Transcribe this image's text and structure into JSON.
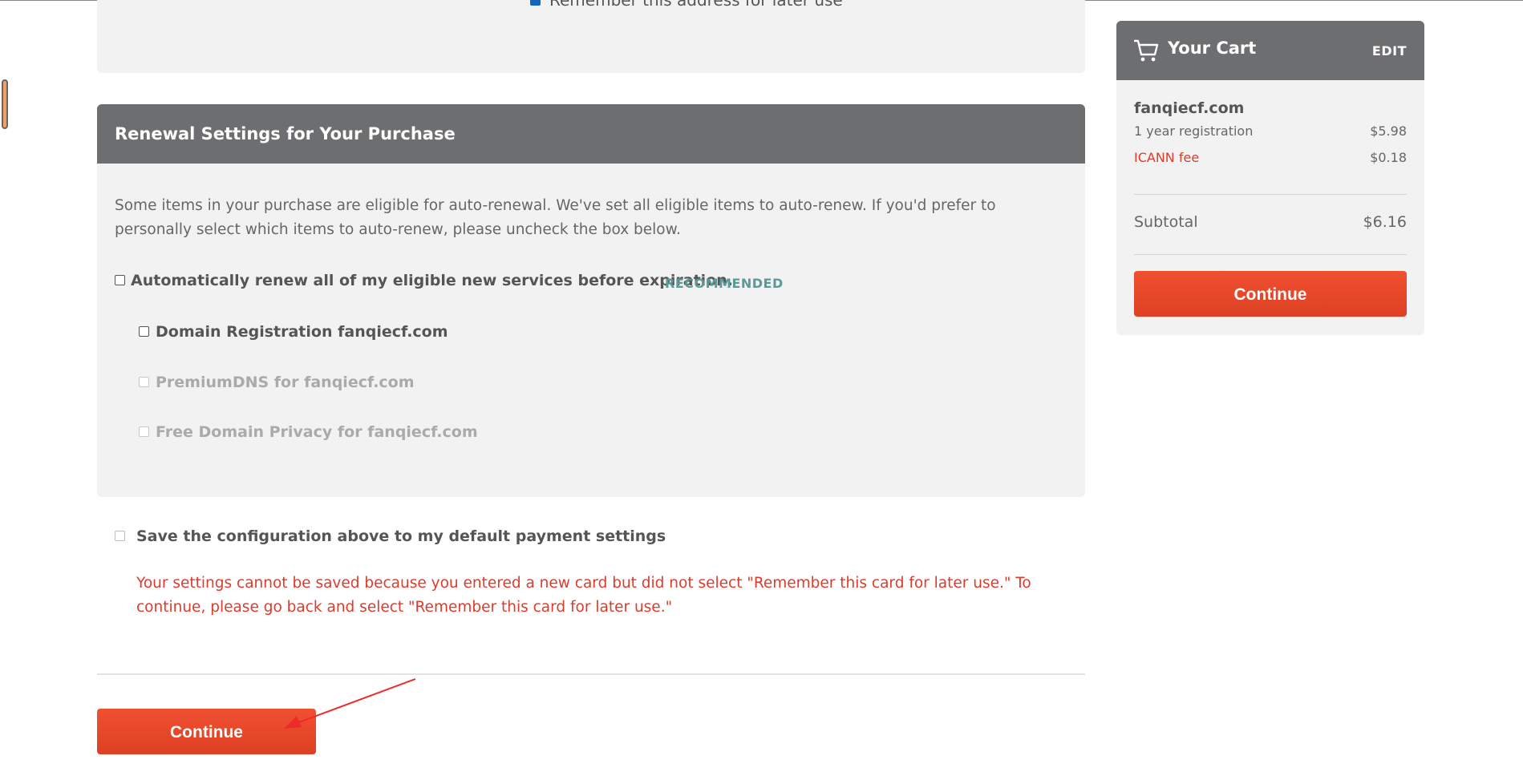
{
  "address": {
    "remember_label": "Remember this address for later use"
  },
  "renewal": {
    "title": "Renewal Settings for Your Purchase",
    "description": "Some items in your purchase are eligible for auto-renewal. We've set all eligible items to auto-renew. If you'd prefer to personally select which items to auto-renew, please uncheck the box below.",
    "auto_renew_all_label": "Automatically renew all of my eligible new services before expiration.",
    "recommended_badge": "RECOMMENDED",
    "items": [
      {
        "label": "Domain Registration fanqiecf.com",
        "enabled": true,
        "checked": false
      },
      {
        "label": "PremiumDNS for fanqiecf.com",
        "enabled": false,
        "checked": false
      },
      {
        "label": "Free Domain Privacy for fanqiecf.com",
        "enabled": false,
        "checked": false
      }
    ]
  },
  "save_config": {
    "label": "Save the configuration above to my default payment settings",
    "error": "Your settings cannot be saved because you entered a new card but did not select \"Remember this card for later use.\" To continue, please go back and select \"Remember this card for later use.\""
  },
  "main": {
    "continue_label": "Continue"
  },
  "cart": {
    "title": "Your Cart",
    "edit_label": "EDIT",
    "icon": "cart-icon",
    "domain": "fanqiecf.com",
    "lines": [
      {
        "label": "1 year registration",
        "price": "$5.98"
      },
      {
        "label": "ICANN fee",
        "price": "$0.18"
      }
    ],
    "subtotal_label": "Subtotal",
    "subtotal_value": "$6.16",
    "continue_label": "Continue"
  },
  "colors": {
    "accent": "#e8482c",
    "header_bg": "#6d6e70",
    "panel_bg": "#f2f2f2",
    "error": "#e03b2a",
    "recommended": "#5b9a98"
  }
}
